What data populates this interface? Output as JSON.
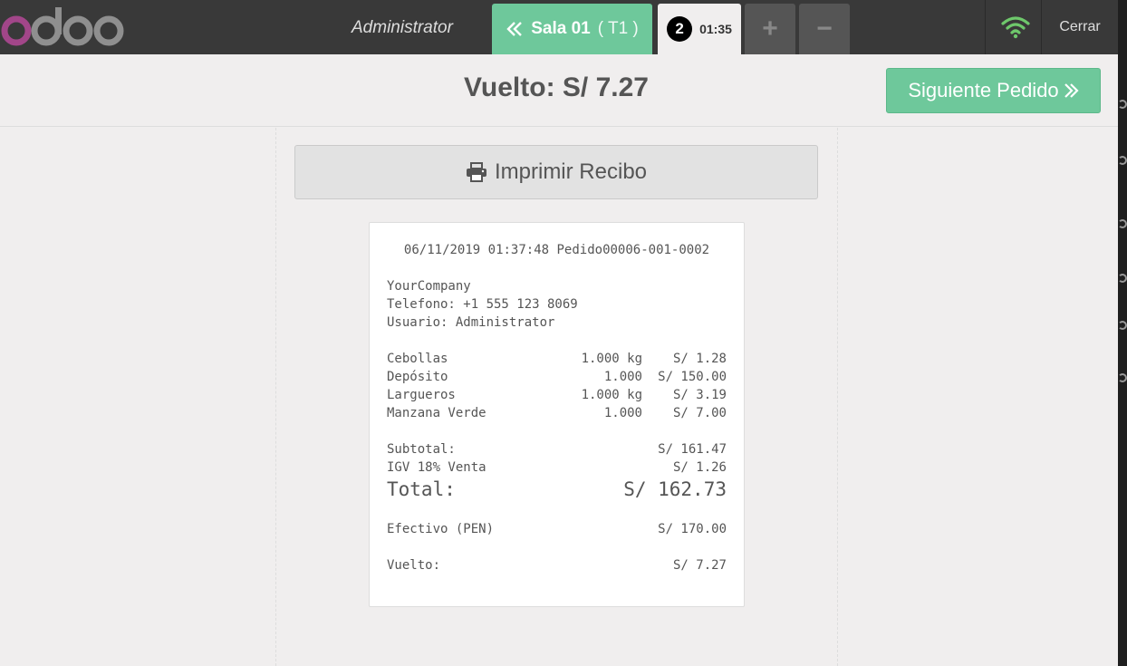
{
  "topbar": {
    "cashier": "Administrator",
    "back_button": {
      "label": "Sala 01",
      "table": "( T1 )"
    },
    "order_tab": {
      "count": "2",
      "time": "01:35"
    },
    "add_order": "+",
    "remove_order": "−",
    "close_label": "Cerrar"
  },
  "screen": {
    "change_title": "Vuelto: S/ 7.27",
    "next_order_label": "Siguiente Pedido",
    "print_label": "Imprimir Recibo"
  },
  "receipt": {
    "header": "06/11/2019 01:37:48 Pedido00006-001-0002",
    "company": "YourCompany",
    "phone": "Telefono: +1 555 123 8069",
    "user": "Usuario: Administrator",
    "lines": [
      {
        "name": "Cebollas",
        "qty": "1.000 kg",
        "price": "S/ 1.28"
      },
      {
        "name": "Depósito",
        "qty": "1.000",
        "price": "S/ 150.00"
      },
      {
        "name": "Largueros",
        "qty": "1.000 kg",
        "price": "S/ 3.19"
      },
      {
        "name": "Manzana Verde",
        "qty": "1.000",
        "price": "S/ 7.00"
      }
    ],
    "subtotal_label": "Subtotal:",
    "subtotal_value": "S/ 161.47",
    "tax_label": "IGV 18% Venta",
    "tax_value": "S/ 1.26",
    "total_label": "Total:",
    "total_value": "S/ 162.73",
    "payment_label": "Efectivo (PEN)",
    "payment_value": "S/ 170.00",
    "change_label": "Vuelto:",
    "change_value": "S/ 7.27"
  },
  "colors": {
    "brand_green": "#6ec89b",
    "topbar": "#393939",
    "wifi_green": "#6ec86b",
    "logo_purple": "#a24689",
    "logo_gray": "#8f8f8f"
  },
  "icons": [
    "odoo-logo",
    "double-chevron-left-icon",
    "plus-icon",
    "minus-icon",
    "wifi-icon",
    "double-chevron-right-icon",
    "printer-icon"
  ]
}
